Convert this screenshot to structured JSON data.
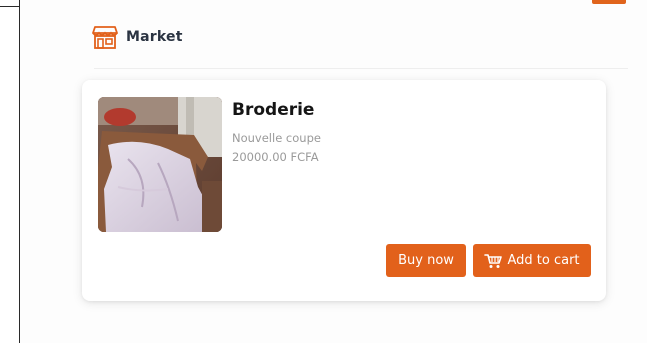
{
  "header": {
    "icon": "storefront-icon",
    "title": "Market"
  },
  "product": {
    "name": "Broderie",
    "subtitle": "Nouvelle coupe",
    "price": "20000.00 FCFA",
    "image": "embroidered-fabric-photo"
  },
  "actions": {
    "buy_label": "Buy now",
    "cart_label": "Add to cart",
    "cart_icon": "shopping-cart-icon"
  },
  "colors": {
    "accent": "#e2611b",
    "title_text": "#2b3442",
    "muted_text": "#9a9a9a"
  }
}
